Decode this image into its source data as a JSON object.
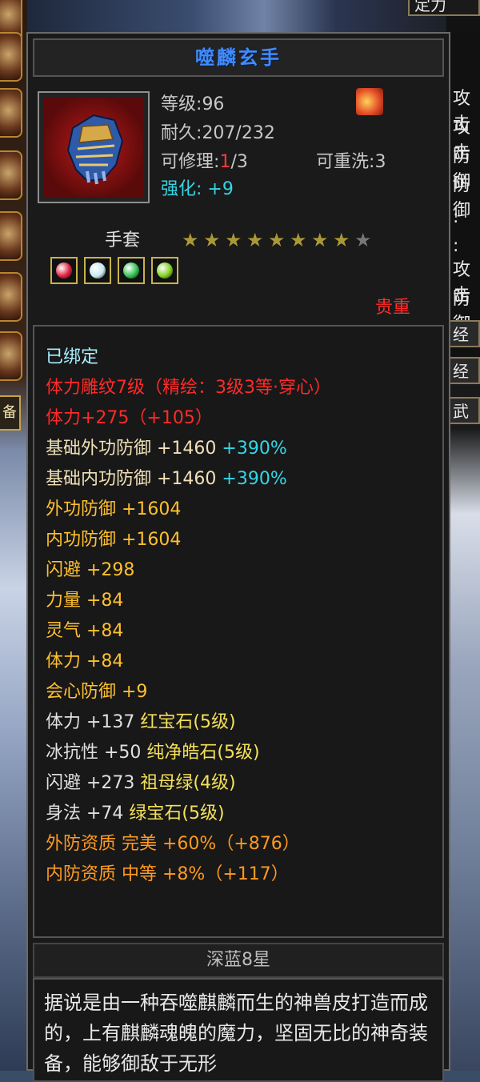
{
  "item": {
    "name": "噬麟玄手",
    "level_label": "等级",
    "level": "96",
    "durability_label": "耐久",
    "durability": "207/232",
    "repair_label": "可修理",
    "repair_current": "1",
    "repair_max": "/3",
    "rewash_label": "可重洗",
    "rewash": "3",
    "enhance_label": "强化",
    "enhance": "+9",
    "type": "手套",
    "stars_total": 9,
    "stars_lit": 8,
    "rarity": "贵重"
  },
  "attributes": [
    {
      "parts": [
        {
          "text": "已绑定",
          "color": "aqua"
        }
      ]
    },
    {
      "parts": [
        {
          "text": "体力雕纹7级（精绘：3级3等·穿心）",
          "color": "red"
        }
      ]
    },
    {
      "parts": [
        {
          "text": "体力+275（+105）",
          "color": "red"
        }
      ]
    },
    {
      "parts": [
        {
          "text": "基础外功防御  +1460 ",
          "color": "beige"
        },
        {
          "text": "+390%",
          "color": "cyan"
        }
      ]
    },
    {
      "parts": [
        {
          "text": "基础内功防御  +1460 ",
          "color": "beige"
        },
        {
          "text": "+390%",
          "color": "cyan"
        }
      ]
    },
    {
      "parts": [
        {
          "text": "外功防御  +1604",
          "color": "gold"
        }
      ]
    },
    {
      "parts": [
        {
          "text": "内功防御  +1604",
          "color": "gold"
        }
      ]
    },
    {
      "parts": [
        {
          "text": "闪避  +298",
          "color": "gold"
        }
      ]
    },
    {
      "parts": [
        {
          "text": "力量  +84",
          "color": "gold"
        }
      ]
    },
    {
      "parts": [
        {
          "text": "灵气  +84",
          "color": "gold"
        }
      ]
    },
    {
      "parts": [
        {
          "text": "体力  +84",
          "color": "gold"
        }
      ]
    },
    {
      "parts": [
        {
          "text": "会心防御  +9",
          "color": "gold"
        }
      ]
    },
    {
      "parts": [
        {
          "text": "体力  +137  ",
          "color": "white"
        },
        {
          "text": "红宝石(5级)",
          "color": "yellow"
        }
      ]
    },
    {
      "parts": [
        {
          "text": "冰抗性  +50  ",
          "color": "white"
        },
        {
          "text": "纯净皓石(5级)",
          "color": "yellow"
        }
      ]
    },
    {
      "parts": [
        {
          "text": "闪避  +273  ",
          "color": "white"
        },
        {
          "text": "祖母绿(4级)",
          "color": "yellow"
        }
      ]
    },
    {
      "parts": [
        {
          "text": "身法  +74  ",
          "color": "white"
        },
        {
          "text": "绿宝石(5级)",
          "color": "yellow"
        }
      ]
    },
    {
      "parts": [
        {
          "text": "外防资质    完美  +60%（+876）",
          "color": "orange"
        }
      ]
    },
    {
      "parts": [
        {
          "text": "内防资质    中等  +8%（+117）",
          "color": "orange"
        }
      ]
    }
  ],
  "set_label": "深蓝8星",
  "description": "据说是由一种吞噬麒麟而生的神兽皮打造而成的，上有麒麟魂魄的魔力，坚固无比的神奇装备，能够御敌于无形",
  "sidebar": {
    "label": "备"
  },
  "right_panel": {
    "header_top": "定力",
    "rows": [
      "攻击",
      "攻击",
      "防御",
      "防御",
      ":",
      ":",
      "攻击",
      "防御"
    ],
    "buttons": [
      "经",
      "经",
      "武"
    ]
  },
  "gems": [
    {
      "icon": "ruby-gem-icon",
      "color": "#e02040"
    },
    {
      "icon": "pure-stone-gem-icon",
      "color": "#c8e8f0"
    },
    {
      "icon": "emerald-gem-icon",
      "color": "#30c050"
    },
    {
      "icon": "green-gem-icon",
      "color": "#80d020"
    }
  ]
}
